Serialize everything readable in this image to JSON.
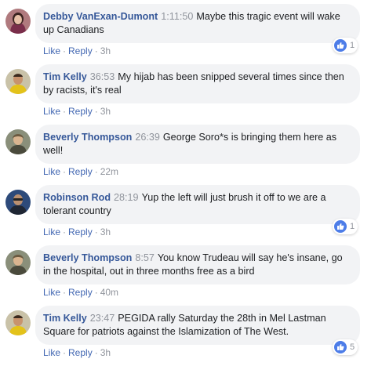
{
  "colors": {
    "name_link": "#365899",
    "action_link": "#4267b2",
    "meta_gray": "#90949c",
    "bubble_bg": "#f2f3f5",
    "like_blue": "#4d7de8"
  },
  "actions": {
    "like_label": "Like",
    "reply_label": "Reply",
    "separator": "·"
  },
  "comments": [
    {
      "author": "Debby VanExan-Dumont",
      "timestamp": "1:11:50",
      "text": "Maybe this tragic event will wake up Canadians",
      "age": "3h",
      "reaction_icon": "thumbs-up-icon",
      "reaction_count": "1"
    },
    {
      "author": "Tim Kelly",
      "timestamp": "36:53",
      "text": "My hijab has been snipped several times since then by racists, it's real",
      "age": "3h"
    },
    {
      "author": "Beverly Thompson",
      "timestamp": "26:39",
      "text": "George Soro*s is bringing them here as well!",
      "age": "22m"
    },
    {
      "author": "Robinson Rod",
      "timestamp": "28:19",
      "text": "Yup the left will just brush it off to we are a tolerant country",
      "age": "3h",
      "reaction_icon": "thumbs-up-icon",
      "reaction_count": "1"
    },
    {
      "author": "Beverly Thompson",
      "timestamp": "8:57",
      "text": "You know Trudeau will say he's insane, go in the hospital, out in three months free as a bird",
      "age": "40m"
    },
    {
      "author": "Tim Kelly",
      "timestamp": "23:47",
      "text": "PEGIDA rally Saturday the 28th in Mel Lastman Square for patriots against the Islamization of The West.",
      "age": "3h",
      "reaction_icon": "thumbs-up-icon",
      "reaction_count": "5"
    }
  ]
}
